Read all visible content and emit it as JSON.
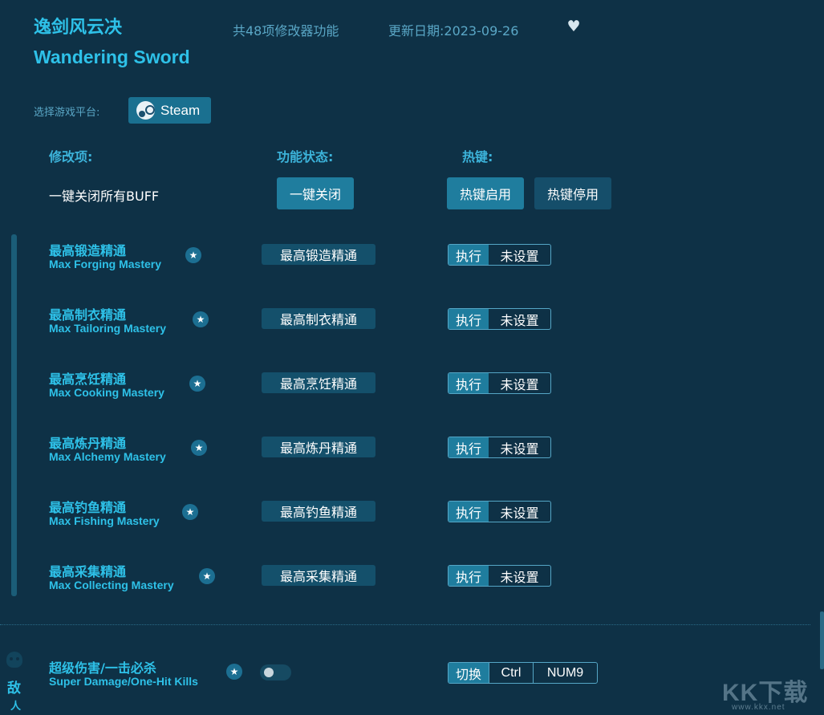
{
  "header": {
    "title_cn": "逸剑风云决",
    "title_en": "Wandering Sword",
    "feature_count": "共48项修改器功能",
    "update_date": "更新日期:2023-09-26",
    "favorite_icon": "heart-icon"
  },
  "platform": {
    "label": "选择游戏平台:",
    "selected": "Steam",
    "icon": "steam-icon"
  },
  "columns": {
    "mod": "修改项:",
    "status": "功能状态:",
    "hotkey": "热键:"
  },
  "global": {
    "close_all_buff_label": "一键关闭所有BUFF",
    "close_all_button": "一键关闭",
    "hotkey_enable": "热键启用",
    "hotkey_disable": "热键停用"
  },
  "cheats": [
    {
      "name_cn": "最高锻造精通",
      "name_en": "Max Forging Mastery",
      "action": "最高锻造精通",
      "exec": "执行",
      "hotkey": "未设置"
    },
    {
      "name_cn": "最高制衣精通",
      "name_en": "Max Tailoring Mastery",
      "action": "最高制衣精通",
      "exec": "执行",
      "hotkey": "未设置"
    },
    {
      "name_cn": "最高烹饪精通",
      "name_en": "Max Cooking Mastery",
      "action": "最高烹饪精通",
      "exec": "执行",
      "hotkey": "未设置"
    },
    {
      "name_cn": "最高炼丹精通",
      "name_en": "Max Alchemy Mastery",
      "action": "最高炼丹精通",
      "exec": "执行",
      "hotkey": "未设置"
    },
    {
      "name_cn": "最高钓鱼精通",
      "name_en": "Max Fishing Mastery",
      "action": "最高钓鱼精通",
      "exec": "执行",
      "hotkey": "未设置"
    },
    {
      "name_cn": "最高采集精通",
      "name_en": "Max Collecting Mastery",
      "action": "最高采集精通",
      "exec": "执行",
      "hotkey": "未设置"
    }
  ],
  "enemy_section": {
    "category": "敌",
    "category_sub": "人",
    "icon": "skull-icon",
    "cheat": {
      "name_cn": "超级伤害/一击必杀",
      "name_en": "Super Damage/One-Hit Kills",
      "toggle_on": false,
      "switch_label": "切换",
      "key1": "Ctrl",
      "key2": "NUM9"
    }
  },
  "watermark": {
    "text": "KK下载",
    "sub": "www.kkx.net"
  },
  "colors": {
    "background": "#0e3146",
    "accent": "#2ec1e8",
    "button": "#1f7d9e"
  }
}
